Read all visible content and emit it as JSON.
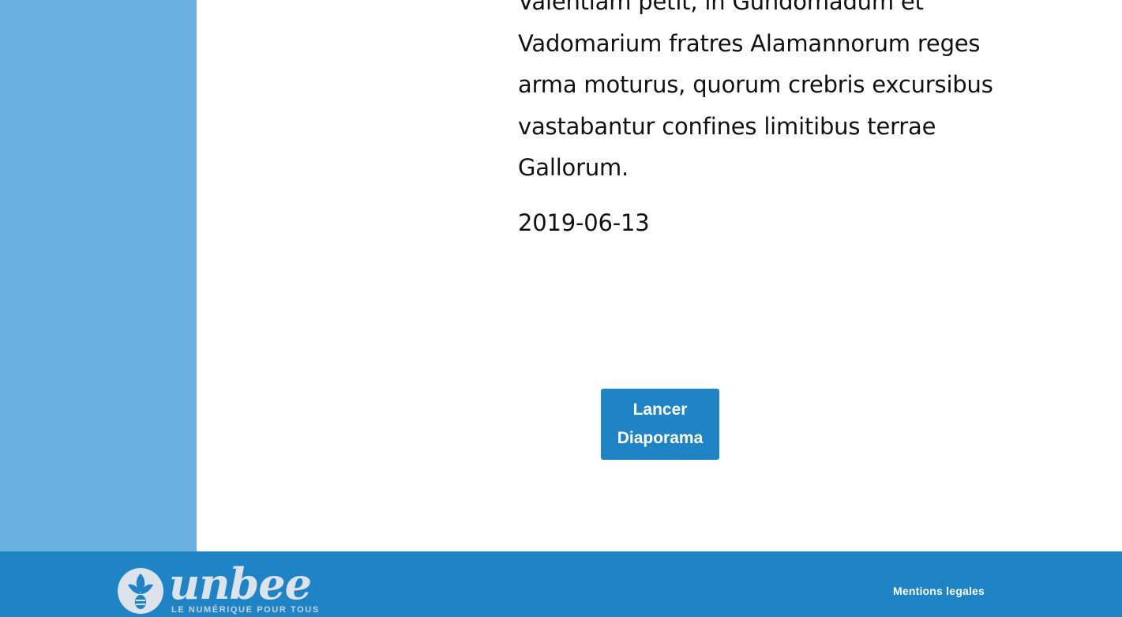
{
  "article": {
    "text": "Valentiam petit, in Gundomadum et Vadomarium fratres Alamannorum reges arma moturus, quorum crebris excursibus vastabantur confines limitibus terrae Gallorum.",
    "date": "2019-06-13"
  },
  "actions": {
    "slideshow_label": "Lancer Diaporama"
  },
  "footer": {
    "logo_wordmark": "unbee",
    "logo_tagline": "LE NUMÉRIQUE POUR TOUS",
    "legal_link": "Mentions legales"
  },
  "icons": {
    "logo": "bee-logo-icon"
  },
  "colors": {
    "sidebar": "#6ab0e0",
    "accent": "#1e84c6",
    "text": "#111111",
    "logo": "#dde3ea"
  }
}
